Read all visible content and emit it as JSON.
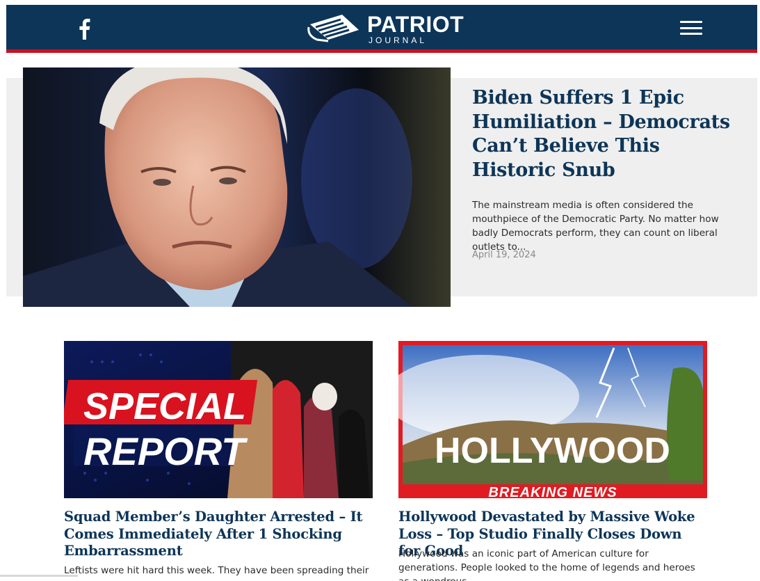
{
  "header": {
    "logo_main": "PATRIOT",
    "logo_sub": "JOURNAL",
    "social_icon": "facebook-icon",
    "menu_icon": "hamburger-menu-icon",
    "colors": {
      "nav_bg": "#0d3558",
      "accent": "#c8101e"
    }
  },
  "hero": {
    "title": "Biden Suffers 1 Epic Humiliation – Democrats Can’t Believe This Historic Snub",
    "excerpt": "The mainstream media is often considered the mouthpiece of the Democratic Party. No matter how badly Democrats perform, they can count on liberal outlets to...",
    "date": "April 19, 2024"
  },
  "cards": [
    {
      "image_text_1": "SPECIAL",
      "image_text_2": "REPORT",
      "title": "Squad Member’s Daughter Arrested – It Comes Immediately After 1 Shocking Embarrassment",
      "excerpt": "Leftists were hit hard this week. They have been spreading their"
    },
    {
      "image_text_1": "HOLLYWOOD",
      "image_text_2": "BREAKING NEWS",
      "title": "Hollywood Devastated by Massive Woke Loss – Top Studio Finally Closes Down for Good",
      "excerpt": "Hollywood was an iconic part of American culture for generations. People looked to the home of legends and heroes as a wondrous"
    }
  ]
}
